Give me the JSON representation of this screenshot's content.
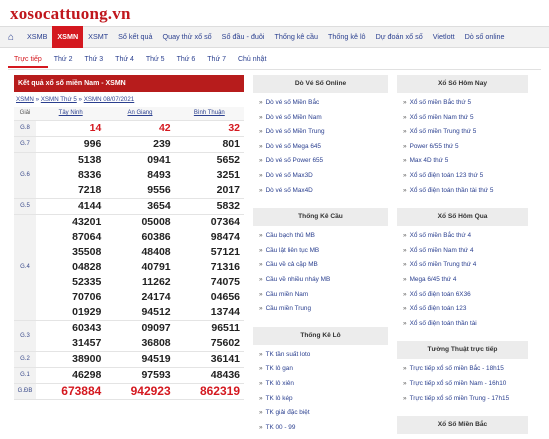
{
  "site": {
    "logo": "xosocattuong.vn"
  },
  "topnav": {
    "items": [
      "XSMB",
      "XSMN",
      "XSMT",
      "Sổ kết quả",
      "Quay thử xổ số",
      "Sổ đầu - đuôi",
      "Thống kê cầu",
      "Thống kê lô",
      "Dự đoán xổ số",
      "Vietlott",
      "Dò số online"
    ],
    "active": "XSMN"
  },
  "subnav": {
    "items": [
      "Trực tiếp",
      "Thứ 2",
      "Thứ 3",
      "Thứ 4",
      "Thứ 5",
      "Thứ 6",
      "Thứ 7",
      "Chủ nhật"
    ],
    "active": "Trực tiếp"
  },
  "results": {
    "title": "Kết quả xổ số miền Nam - XSMN",
    "breadcrumb": [
      "XSMN",
      "XSMN Thứ 5",
      "XSMN 08/07/2021"
    ],
    "breadcrumb_sep": " » ",
    "header": {
      "label": "Giải",
      "provinces": [
        "Tây Ninh",
        "An Giang",
        "Bình Thuận"
      ]
    },
    "rows": [
      {
        "prize": "G.8",
        "values": [
          [
            "14"
          ],
          [
            "42"
          ],
          [
            "32"
          ]
        ],
        "style": "red"
      },
      {
        "prize": "G.7",
        "values": [
          [
            "996"
          ],
          [
            "239"
          ],
          [
            "801"
          ]
        ]
      },
      {
        "prize": "G.6",
        "values": [
          [
            "5138",
            "8336",
            "7218"
          ],
          [
            "0941",
            "8493",
            "9556"
          ],
          [
            "5652",
            "3251",
            "2017"
          ]
        ]
      },
      {
        "prize": "G.5",
        "values": [
          [
            "4144"
          ],
          [
            "3654"
          ],
          [
            "5832"
          ]
        ]
      },
      {
        "prize": "G.4",
        "values": [
          [
            "43201",
            "87064",
            "35508",
            "04828",
            "52335",
            "70706",
            "01929"
          ],
          [
            "05008",
            "60386",
            "48408",
            "40791",
            "11262",
            "24174",
            "94512"
          ],
          [
            "07364",
            "98474",
            "57121",
            "71316",
            "74075",
            "04656",
            "13744"
          ]
        ]
      },
      {
        "prize": "G.3",
        "values": [
          [
            "60343",
            "31457"
          ],
          [
            "09097",
            "36808"
          ],
          [
            "96511",
            "75602"
          ]
        ]
      },
      {
        "prize": "G.2",
        "values": [
          [
            "38900"
          ],
          [
            "94519"
          ],
          [
            "36141"
          ]
        ]
      },
      {
        "prize": "G.1",
        "values": [
          [
            "46298"
          ],
          [
            "97593"
          ],
          [
            "48436"
          ]
        ]
      },
      {
        "prize": "G.ĐB",
        "values": [
          [
            "673884"
          ],
          [
            "942923"
          ],
          [
            "862319"
          ]
        ],
        "style": "red-big"
      }
    ]
  },
  "boxes_mid": [
    {
      "title": "Dò Vé Số Online",
      "items": [
        "Dò vé số Miền Bắc",
        "Dò vé số Miền Nam",
        "Dò vé số Miền Trung",
        "Dò vé số Mega 645",
        "Dò vé số Power 655",
        "Dò vé số Max3D",
        "Dò vé số Max4D"
      ]
    },
    {
      "title": "Thống Kê Cầu",
      "items": [
        "Cầu bạch thủ MB",
        "Cầu lật liên tục MB",
        "Cầu về cả cặp MB",
        "Cầu về nhiều nháy MB",
        "Cầu miền Nam",
        "Cầu miền Trung"
      ]
    },
    {
      "title": "Thống Kê Lô",
      "items": [
        "TK tần suất loto",
        "TK lô gan",
        "TK lô xiên",
        "TK lô kép",
        "TK giải đặc biệt",
        "TK 00 - 99"
      ]
    }
  ],
  "boxes_right": [
    {
      "title": "Xổ Số Hôm Nay",
      "items": [
        "Xổ số miền Bắc thứ 5",
        "Xổ số miền Nam thứ 5",
        "Xổ số miền Trung thứ 5",
        "Power 6/55 thứ 5",
        "Max 4D thứ 5",
        "Xổ số điện toán 123 thứ 5",
        "Xổ số điện toán thần tài thứ 5"
      ]
    },
    {
      "title": "Xổ Số Hôm Qua",
      "items": [
        "Xổ số miền Bắc thứ 4",
        "Xổ số miền Nam thứ 4",
        "Xổ số miền Trung thứ 4",
        "Mega 6/45 thứ 4",
        "Xổ số điện toán 6X36",
        "Xổ số điện toán 123",
        "Xổ số điện toán thần tài"
      ]
    },
    {
      "title": "Tường Thuật trực tiếp",
      "items": [
        "Trực tiếp xổ số miền Bắc - 18h15",
        "Trực tiếp xổ số miền Nam - 16h10",
        "Trực tiếp xổ số miền Trung - 17h15"
      ]
    },
    {
      "title": "Xổ Số Miền Bắc",
      "items": []
    }
  ],
  "icons": {
    "home": "home-icon"
  },
  "colors": {
    "brand_red": "#d4181f",
    "link_blue": "#2a3f8f",
    "header_red": "#b71c1c"
  }
}
